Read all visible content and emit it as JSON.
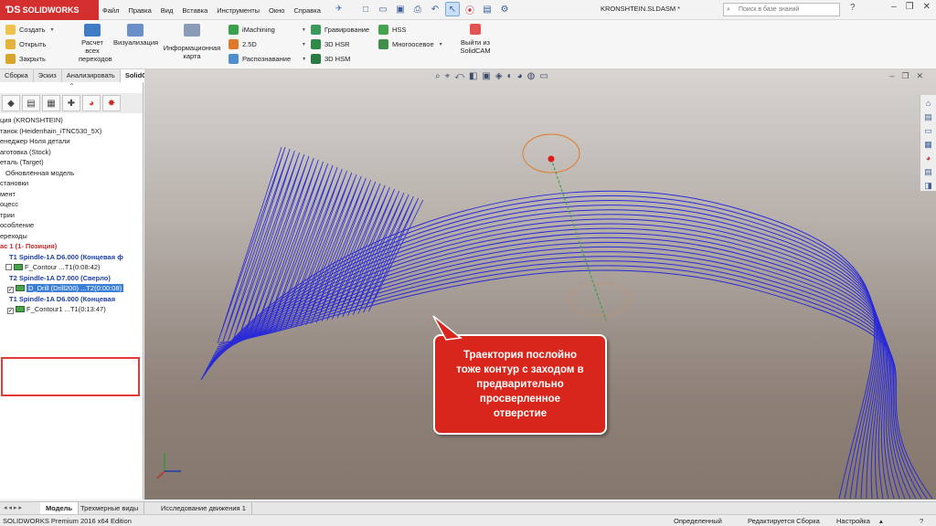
{
  "app": {
    "brand": "SOLIDWORKS",
    "doc_title": "KRONSHTEIN.SLDASM *"
  },
  "menu": [
    "Файл",
    "Правка",
    "Вид",
    "Вставка",
    "Инструменты",
    "Окно",
    "Справка"
  ],
  "search": {
    "placeholder": "Поиск в базе знаний"
  },
  "commands": {
    "create": "Создать",
    "open": "Открыть",
    "close": "Закрыть",
    "calc_all": [
      "Расчет",
      "всех",
      "переходов"
    ],
    "visualization": "Визуализация",
    "info_map": [
      "Информационная",
      "карта"
    ],
    "imachining": "iMachining",
    "two_five_d": "2.5D",
    "recognition": "Распознавание",
    "engraving": "Гравирование",
    "hsr": "3D HSR",
    "hsm": "3D HSM",
    "hss": "HSS",
    "multiaxis": "Многоосевое",
    "exit_solidcam": [
      "Выйти из",
      "SolidCAM"
    ]
  },
  "tabs": [
    "Сборка",
    "Эскиз",
    "Анализировать",
    "SolidCAM Переходы"
  ],
  "tree": [
    "ция (KRONSHTEIN)",
    "танок (Heidenhain_iTNC530_5X)",
    "енеджер Ноля детали",
    "аготовка (Stock)",
    "еталь (Target)",
    "Обновлённая модель",
    "становки",
    "мент",
    "оцесс",
    "трии",
    "особление",
    "ереходы"
  ],
  "ops": {
    "setup": "ас 1 (1- Позиция)",
    "t1": "T1 Spindle-1A D6.000  (Концевая ф",
    "op1": "F_Contour ...T1(0:08:42)",
    "t2": "T2 Spindle-1A D7.000  (Сверло)",
    "op2": "D_Drill (Drill200) ...T2(0:00:08)",
    "t3": "T1 Spindle-1A D6.000  (Концевая",
    "op3": "F_Contour1 ...T1(0:13:47)"
  },
  "callout": {
    "lines": [
      "Траектория послойно",
      "тоже контур с заходом в",
      "предварительно",
      "просверленное",
      "отверстие"
    ]
  },
  "bottom_tabs": [
    "Модель",
    "Трехмерные виды",
    "Исследование движения 1"
  ],
  "status": {
    "edition": "SOLIDWORKS Premium 2016 x64 Edition",
    "defined": "Определенный",
    "editing": "Редактируется Сборка",
    "settings": "Настройка"
  },
  "colors": {
    "brand_red": "#d32f2f",
    "toolpath_blue": "#2a2ad8",
    "callout_red": "#d9261c",
    "selection_blue": "#3c7fd7"
  }
}
